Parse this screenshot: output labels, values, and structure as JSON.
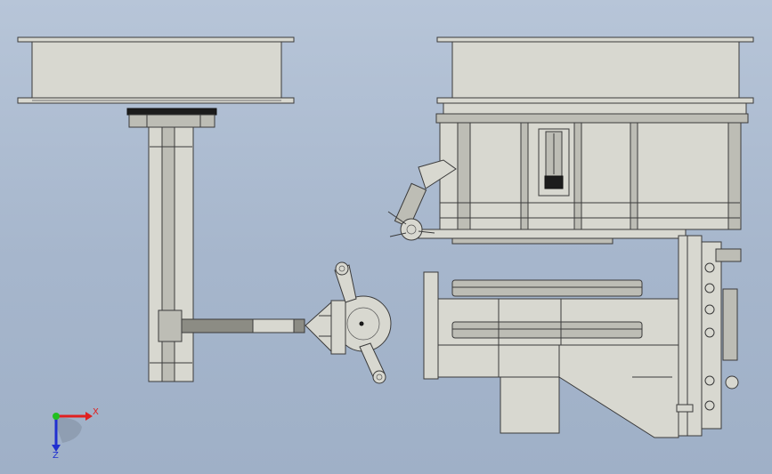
{
  "viewport": {
    "background_top": "#b7c5d8",
    "background_bottom": "#9fb0c7"
  },
  "triad": {
    "x_label": "X",
    "z_label": "Z",
    "x_color": "#e02020",
    "y_color": "#20c020",
    "z_color": "#2030d0"
  }
}
